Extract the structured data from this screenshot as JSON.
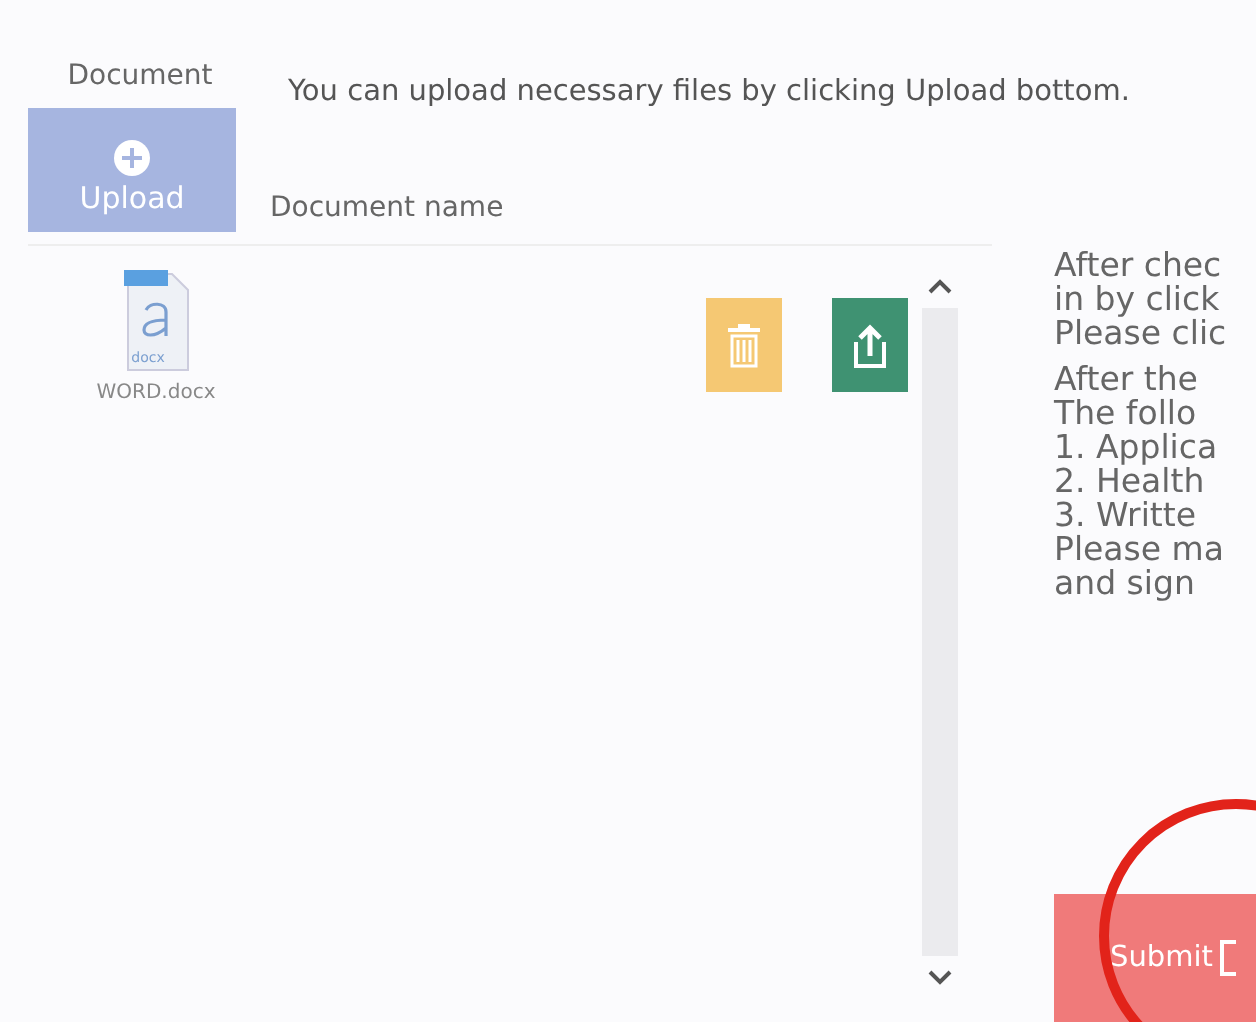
{
  "section_label": "Document",
  "instruction": "You can upload necessary files by clicking Upload bottom.",
  "upload_button": {
    "label": "Upload"
  },
  "list_header": "Document name",
  "files": [
    {
      "name": "WORD.docx",
      "icon_label": "docx"
    }
  ],
  "side_text": {
    "paragraphs": [
      [
        "After chec",
        "in by click",
        "Please clic"
      ],
      [
        "After the",
        "The follo",
        "1. Applica",
        "2. Health",
        "3. Writte",
        "Please ma",
        "and sign"
      ]
    ]
  },
  "submit_button": {
    "label": "Submit"
  }
}
